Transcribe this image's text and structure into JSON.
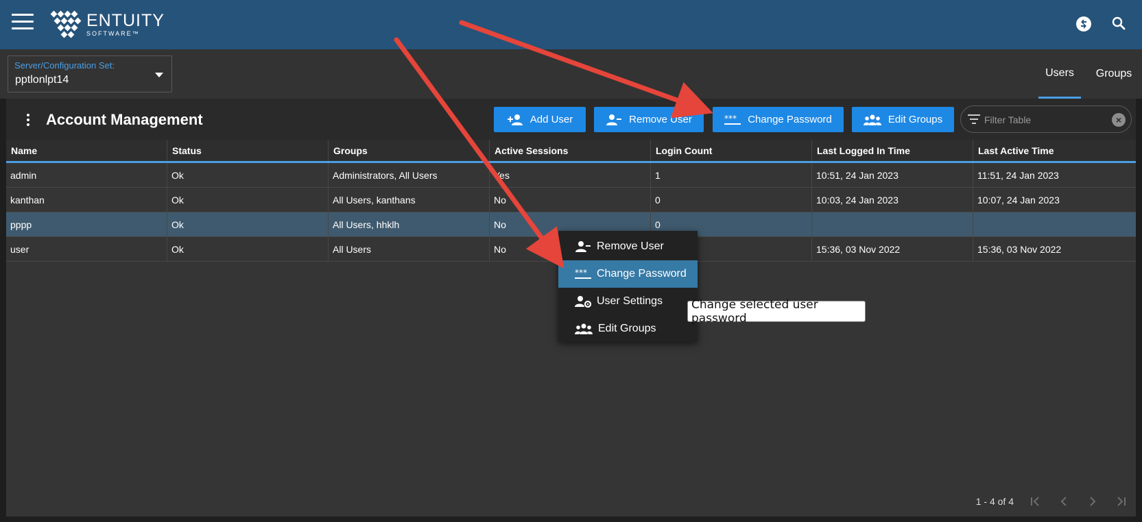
{
  "app": {
    "logo_name": "ENTUITY",
    "logo_sub": "SOFTWARE™"
  },
  "server": {
    "label": "Server/Configuration Set:",
    "value": "pptlonlpt14"
  },
  "tabs": {
    "users": "Users",
    "groups": "Groups"
  },
  "panel": {
    "title": "Account Management"
  },
  "toolbar": {
    "add_user": "Add User",
    "remove_user": "Remove User",
    "change_password": "Change Password",
    "edit_groups": "Edit Groups"
  },
  "filter": {
    "placeholder": "Filter Table"
  },
  "table": {
    "columns": [
      "Name",
      "Status",
      "Groups",
      "Active Sessions",
      "Login Count",
      "Last Logged In Time",
      "Last Active Time"
    ],
    "rows": [
      [
        "admin",
        "Ok",
        "Administrators, All Users",
        "Yes",
        "1",
        "10:51, 24 Jan 2023",
        "11:51, 24 Jan 2023"
      ],
      [
        "kanthan",
        "Ok",
        "All Users, kanthans",
        "No",
        "0",
        "10:03, 24 Jan 2023",
        "10:07, 24 Jan 2023"
      ],
      [
        "pppp",
        "Ok",
        "All Users, hhklh",
        "No",
        "0",
        "",
        ""
      ],
      [
        "user",
        "Ok",
        "All Users",
        "No",
        "",
        "15:36, 03 Nov 2022",
        "15:36, 03 Nov 2022"
      ]
    ],
    "selected_row": 2
  },
  "pager": {
    "text": "1 - 4 of 4"
  },
  "context_menu": {
    "items": [
      "Remove User",
      "Change Password",
      "User Settings",
      "Edit Groups"
    ],
    "active_item": 1
  },
  "tooltip": {
    "text": "Change selected user password"
  },
  "colors": {
    "topbar": "#26537a",
    "accent": "#1e88e5",
    "tab_underline": "#4a9fe5",
    "annotation_arrow": "#e5453a"
  },
  "icons": [
    "menu-icon",
    "logo-icon",
    "account-switch-icon",
    "search-icon",
    "kebab-icon",
    "add-user-icon",
    "remove-user-icon",
    "password-icon",
    "group-icon",
    "filter-icon",
    "clear-icon",
    "user-settings-icon",
    "first-page-icon",
    "prev-page-icon",
    "next-page-icon",
    "last-page-icon"
  ]
}
